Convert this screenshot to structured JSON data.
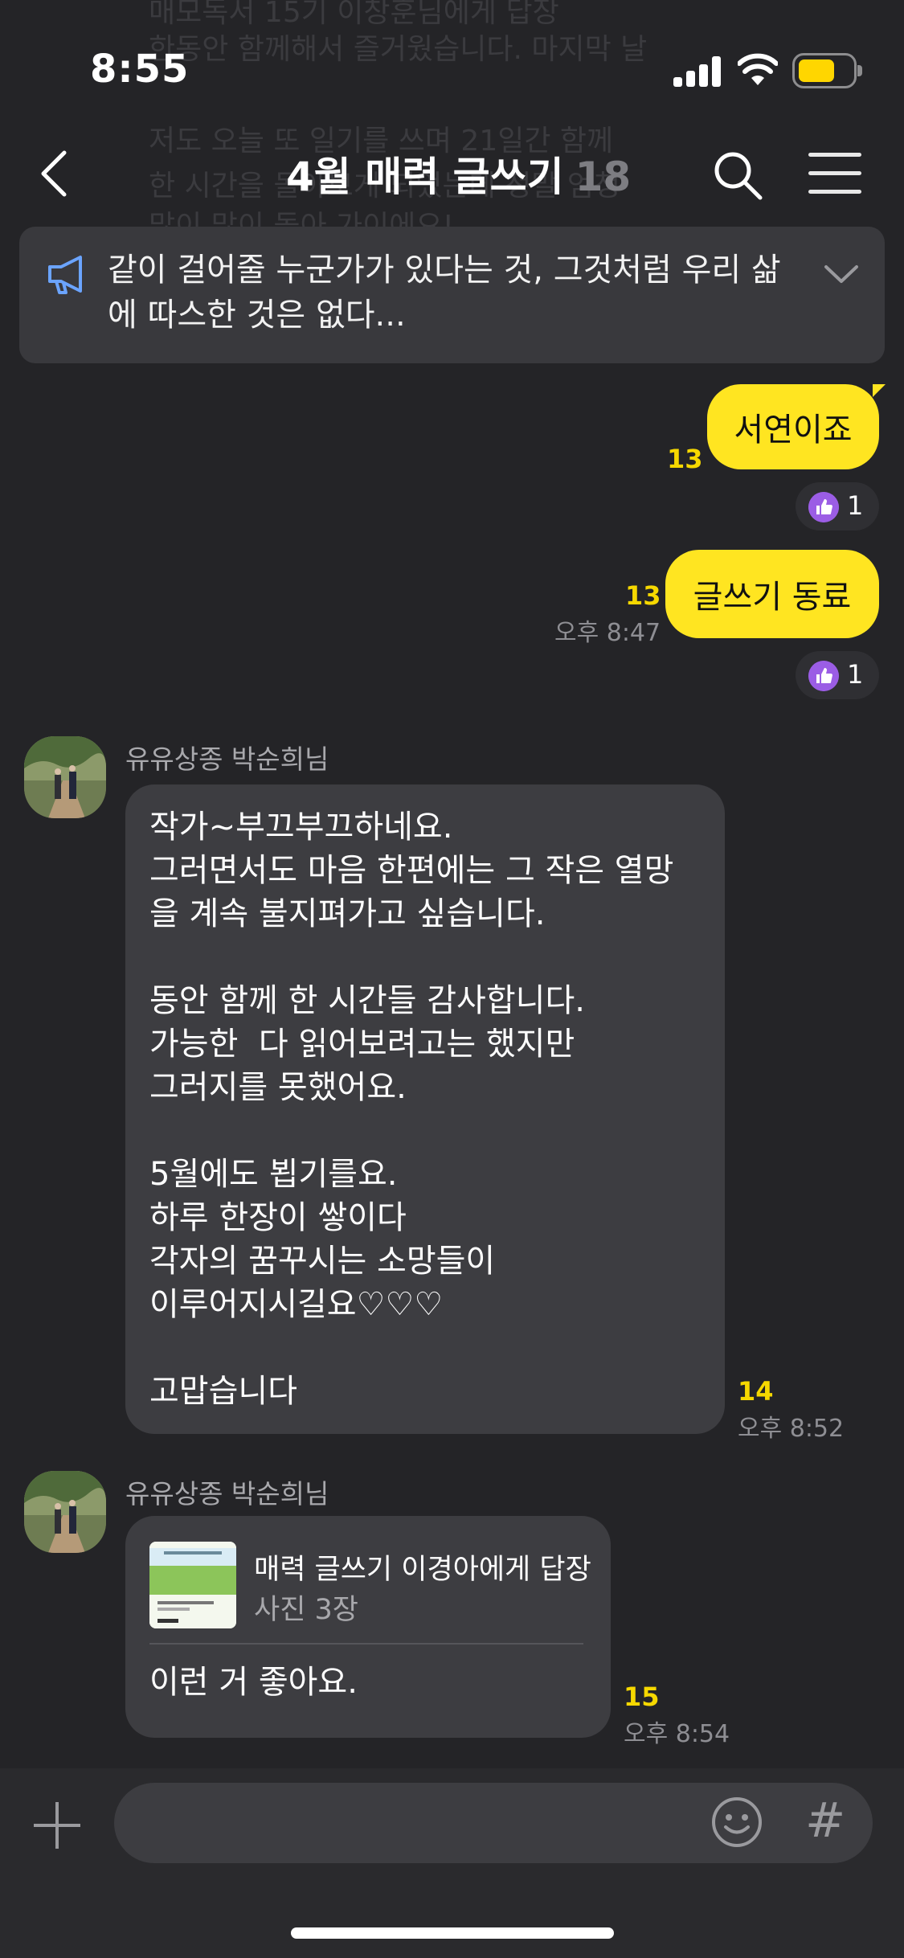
{
  "status": {
    "time": "8:55"
  },
  "background_text": [
    "매모독서 15기 이창훈님에게 답장",
    "한동안 함께해서 즐거웠습니다. 마지막 날",
    "저도 오늘 또 일기를 쓰며 21일간 함께",
    "한 시간을 돌아보게 되었는데 정말 엄청",
    "많이 많이 돌아 가이에요!"
  ],
  "header": {
    "title": "4월 매력 글쓰기",
    "member_count": "18"
  },
  "notice": {
    "text": "같이 걸어줄 누군가가 있다는 것, 그것처럼 우리 삶에 따스한 것은 없다..."
  },
  "my_messages": [
    {
      "text": "서연이죠",
      "unread": "13",
      "time": "",
      "reaction_count": "1"
    },
    {
      "text": "글쓰기 동료",
      "unread": "13",
      "time": "오후 8:47",
      "reaction_count": "1"
    }
  ],
  "other_messages": [
    {
      "sender": "유유상종 박순희님",
      "lines": [
        "작가~부끄부끄하네요.",
        "그러면서도 마음 한편에는 그 작은 열망",
        "을 계속 불지펴가고 싶습니다.",
        "",
        "동안 함께 한 시간들 감사합니다.",
        "가능한  다 읽어보려고는 했지만",
        "그러지를 못했어요.",
        "",
        "5월에도 뵙기를요.",
        "하루 한장이 쌓이다",
        "각자의 꿈꾸시는 소망들이",
        "이루어지시길요♡♡♡",
        "",
        "고맙습니다"
      ],
      "unread": "14",
      "time": "오후 8:52"
    },
    {
      "sender": "유유상종 박순희님",
      "reply_to": {
        "title": "매력 글쓰기 이경아에게 답장",
        "subtitle": "사진 3장"
      },
      "text": "이런 거 좋아요.",
      "unread": "15",
      "time": "오후 8:54"
    }
  ],
  "colors": {
    "background": "#242427",
    "my_bubble": "#ffe521",
    "other_bubble": "#3d3d41",
    "unread": "#f6d800",
    "reaction": "#9b5de5"
  },
  "icons": [
    "back-arrow-icon",
    "search-icon",
    "menu-icon",
    "megaphone-icon",
    "chevron-down-icon",
    "thumbs-up-icon",
    "plus-icon",
    "emoji-icon",
    "hashtag-icon"
  ]
}
